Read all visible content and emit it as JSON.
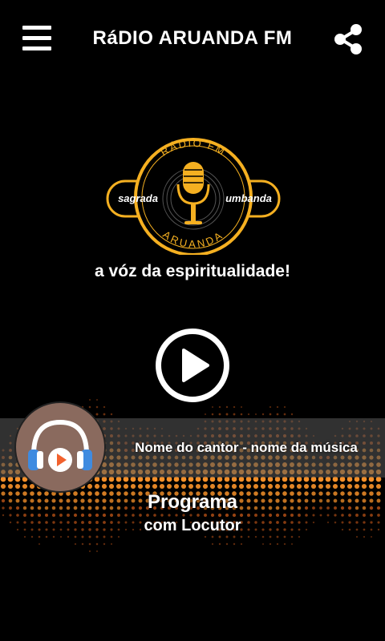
{
  "app": {
    "title": "RáDIO ARUANDA FM",
    "menu_icon": "hamburger-menu-icon",
    "share_icon": "share-icon"
  },
  "logo": {
    "top_text": "RÁDIO FM",
    "left_text": "sagrada",
    "right_text": "umbanda",
    "bottom_text": "ARUANDA",
    "icon": "microphone-icon",
    "colors": {
      "ring": "#f5b021",
      "mic": "#f5b021"
    }
  },
  "slogan": "a vóz da espiritualidade!",
  "player": {
    "play_icon": "play-icon",
    "now_playing": "Nome do cantor - nome da música",
    "cover_icon": "headphones-play-icon",
    "program": "Programa",
    "host": "com Locutor"
  },
  "colors": {
    "background": "#000000",
    "accent_orange": "#f58a1f",
    "avatar_bg": "#8a6a5e",
    "headphone_blue": "#3f8be0"
  }
}
